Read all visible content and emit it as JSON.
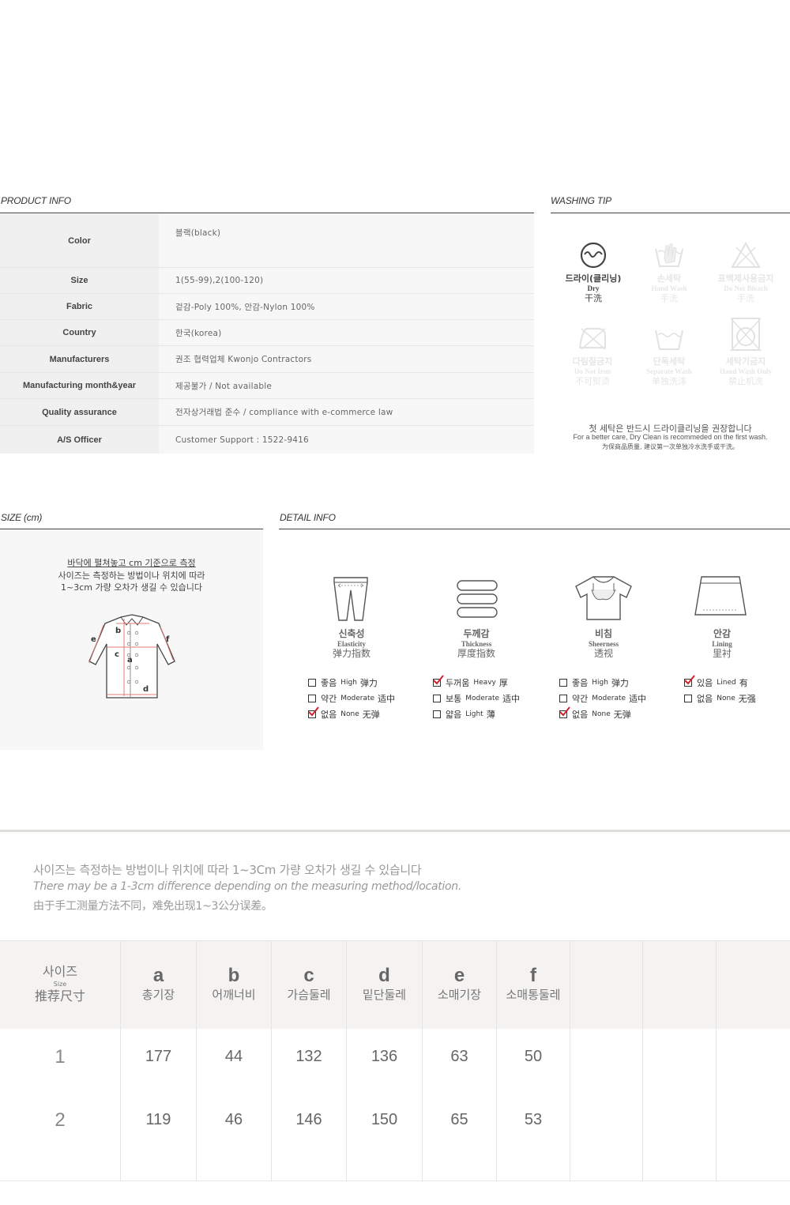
{
  "product_info": {
    "title": "PRODUCT INFO",
    "rows": [
      {
        "label": "Color",
        "value": "블랙(black)"
      },
      {
        "label": "Size",
        "value": "1(55-99),2(100-120)"
      },
      {
        "label": "Fabric",
        "value": "겉감-Poly 100%, 안감-Nylon 100%"
      },
      {
        "label": "Country",
        "value": "한국(korea)"
      },
      {
        "label": "Manufacturers",
        "value": "권조 협력업체 Kwonjo Contractors"
      },
      {
        "label": "Manufacturing month&year",
        "value": "제공불가 / Not available"
      },
      {
        "label": "Quality assurance",
        "value": "전자상거래법 준수 / compliance with e-commerce law"
      },
      {
        "label": "A/S Officer",
        "value": "Customer Support : 1522-9416"
      }
    ]
  },
  "washing": {
    "title": "WASHING TIP",
    "items": [
      {
        "ko": "드라이(클리닝)",
        "en": "Dry",
        "zh": "干洗",
        "icon": "dry-clean-icon",
        "active": true
      },
      {
        "ko": "손세탁",
        "en": "Hand Wash",
        "zh": "手洗",
        "icon": "hand-wash-icon",
        "active": false
      },
      {
        "ko": "표백제사용금지",
        "en": "Do Not Bleach",
        "zh": "手洗",
        "icon": "no-bleach-icon",
        "active": false
      },
      {
        "ko": "다림질금지",
        "en": "Do Not Iron",
        "zh": "不可熨烫",
        "icon": "no-iron-icon",
        "active": false
      },
      {
        "ko": "단독세탁",
        "en": "Separate Wash",
        "zh": "单独洗涤",
        "icon": "separate-wash-icon",
        "active": false
      },
      {
        "ko": "세탁기금지",
        "en": "Hand Wash Only",
        "zh": "禁止机洗",
        "icon": "no-machine-wash-icon",
        "active": false
      }
    ],
    "note_ko": "첫 세탁은 반드시 드라이클리닝을 권장합니다",
    "note_en": "For a better care, Dry Clean is recommeded on the first wash.",
    "note_zh": "为保商品质量, 建议第一次单独冷水洗手或干洗。"
  },
  "size_section": {
    "title": "SIZE (cm)",
    "note1": "바닥에 펼쳐놓고 cm 기준으로 측정",
    "note2": "사이즈는 측정하는 방법이나 위치에 따라",
    "note3": "1~3cm 가량 오차가 생길 수 있습니다",
    "diagram_labels": [
      "a",
      "b",
      "c",
      "d",
      "e",
      "f"
    ]
  },
  "detail_info": {
    "title": "DETAIL INFO",
    "attributes": [
      {
        "ko": "신축성",
        "en": "Elasticity",
        "zh": "弹力指数",
        "icon": "pants-icon",
        "options": [
          {
            "ko": "좋음",
            "en": "High",
            "zh": "弹力",
            "checked": false
          },
          {
            "ko": "약간",
            "en": "Moderate",
            "zh": "适中",
            "checked": false
          },
          {
            "ko": "없음",
            "en": "None",
            "zh": "无弹",
            "checked": true
          }
        ]
      },
      {
        "ko": "두께감",
        "en": "Thickness",
        "zh": "厚度指数",
        "icon": "layers-icon",
        "options": [
          {
            "ko": "두꺼움",
            "en": "Heavy",
            "zh": "厚",
            "checked": true
          },
          {
            "ko": "보통",
            "en": "Moderate",
            "zh": "适中",
            "checked": false
          },
          {
            "ko": "얇음",
            "en": "Light",
            "zh": "薄",
            "checked": false
          }
        ]
      },
      {
        "ko": "비침",
        "en": "Sheerness",
        "zh": "透视",
        "icon": "tshirt-icon",
        "options": [
          {
            "ko": "좋음",
            "en": "High",
            "zh": "弹力",
            "checked": false
          },
          {
            "ko": "약간",
            "en": "Moderate",
            "zh": "适中",
            "checked": false
          },
          {
            "ko": "없음",
            "en": "None",
            "zh": "无弹",
            "checked": true
          }
        ]
      },
      {
        "ko": "안감",
        "en": "Lining",
        "zh": "里衬",
        "icon": "skirt-icon",
        "options": [
          {
            "ko": "있음",
            "en": "Lined",
            "zh": "有",
            "checked": true
          },
          {
            "ko": "없음",
            "en": "None",
            "zh": "无强",
            "checked": false
          }
        ]
      }
    ]
  },
  "size_table": {
    "note_ko": "사이즈는 측정하는 방법이나 위치에 따라 1~3Cm 가량 오차가 생길 수 있습니다",
    "note_en": "There may be a 1-3cm difference depending on the measuring method/location.",
    "note_zh": "由于手工测量方法不同，难免出现1~3公分误差。",
    "size_header": {
      "ko": "사이즈",
      "en": "Size",
      "zh": "推荐尺寸"
    },
    "columns": [
      {
        "letter": "a",
        "ko": "총기장"
      },
      {
        "letter": "b",
        "ko": "어깨너비"
      },
      {
        "letter": "c",
        "ko": "가슴둘레"
      },
      {
        "letter": "d",
        "ko": "밑단둘레"
      },
      {
        "letter": "e",
        "ko": "소매기장"
      },
      {
        "letter": "f",
        "ko": "소매통둘레"
      }
    ],
    "rows": [
      {
        "size": "1",
        "values": [
          "177",
          "44",
          "132",
          "136",
          "63",
          "50"
        ]
      },
      {
        "size": "2",
        "values": [
          "119",
          "46",
          "146",
          "150",
          "65",
          "53"
        ]
      }
    ]
  }
}
